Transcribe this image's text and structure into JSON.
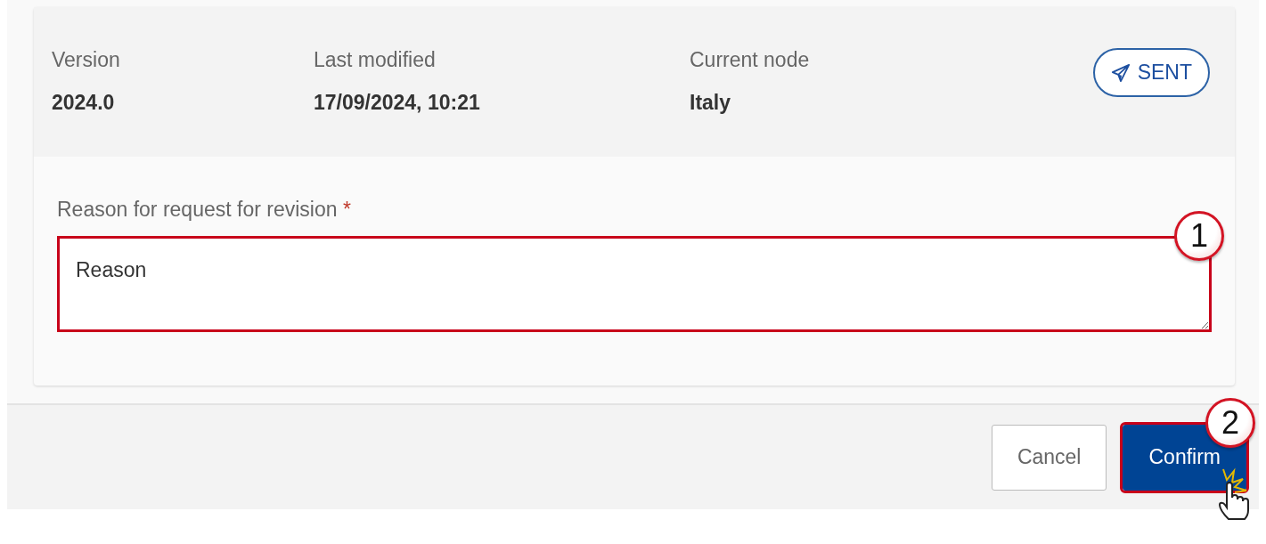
{
  "details": [
    {
      "label": "Version",
      "value": "2024.0"
    },
    {
      "label": "Last modified",
      "value": "17/09/2024, 10:21"
    },
    {
      "label": "Current node",
      "value": "Italy"
    }
  ],
  "status_badge": {
    "label": "SENT"
  },
  "reason_field": {
    "label": "Reason for request for revision",
    "required_mark": "*",
    "value": "Reason",
    "highlighted": true,
    "callout": "1"
  },
  "buttons": [
    {
      "label": "Cancel",
      "kind": "secondary",
      "highlighted": false
    },
    {
      "label": "Confirm",
      "kind": "primary",
      "highlighted": true,
      "callout": "2"
    }
  ]
}
